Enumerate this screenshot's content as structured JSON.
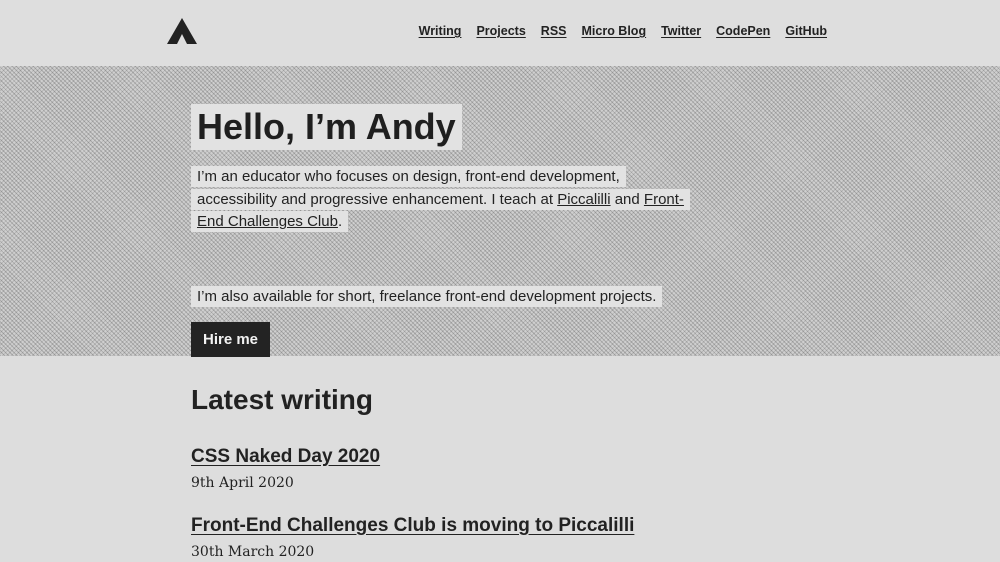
{
  "header": {
    "logo_icon": "triangle-logo-icon",
    "nav": [
      "Writing",
      "Projects",
      "RSS",
      "Micro Blog",
      "Twitter",
      "CodePen",
      "GitHub"
    ]
  },
  "hero": {
    "title": "Hello, I’m Andy",
    "intro_before": "I’m an educator who focuses on design, front-end development, accessibility and progressive enhancement. I teach at ",
    "intro_link1": "Piccalilli",
    "intro_middle": " and ",
    "intro_link2": "Front-End Challenges Club",
    "intro_after": ".",
    "availability": "I’m also available for short, freelance front-end development projects.",
    "hire_label": "Hire me"
  },
  "latest": {
    "heading": "Latest writing",
    "posts": [
      {
        "title": "CSS Naked Day 2020",
        "date": "9th April 2020"
      },
      {
        "title": "Front-End Challenges Club is moving to Piccalilli",
        "date": "30th March 2020"
      }
    ]
  },
  "colors": {
    "page_background": "#dddddd",
    "text": "#222222",
    "button_background": "#232323"
  }
}
